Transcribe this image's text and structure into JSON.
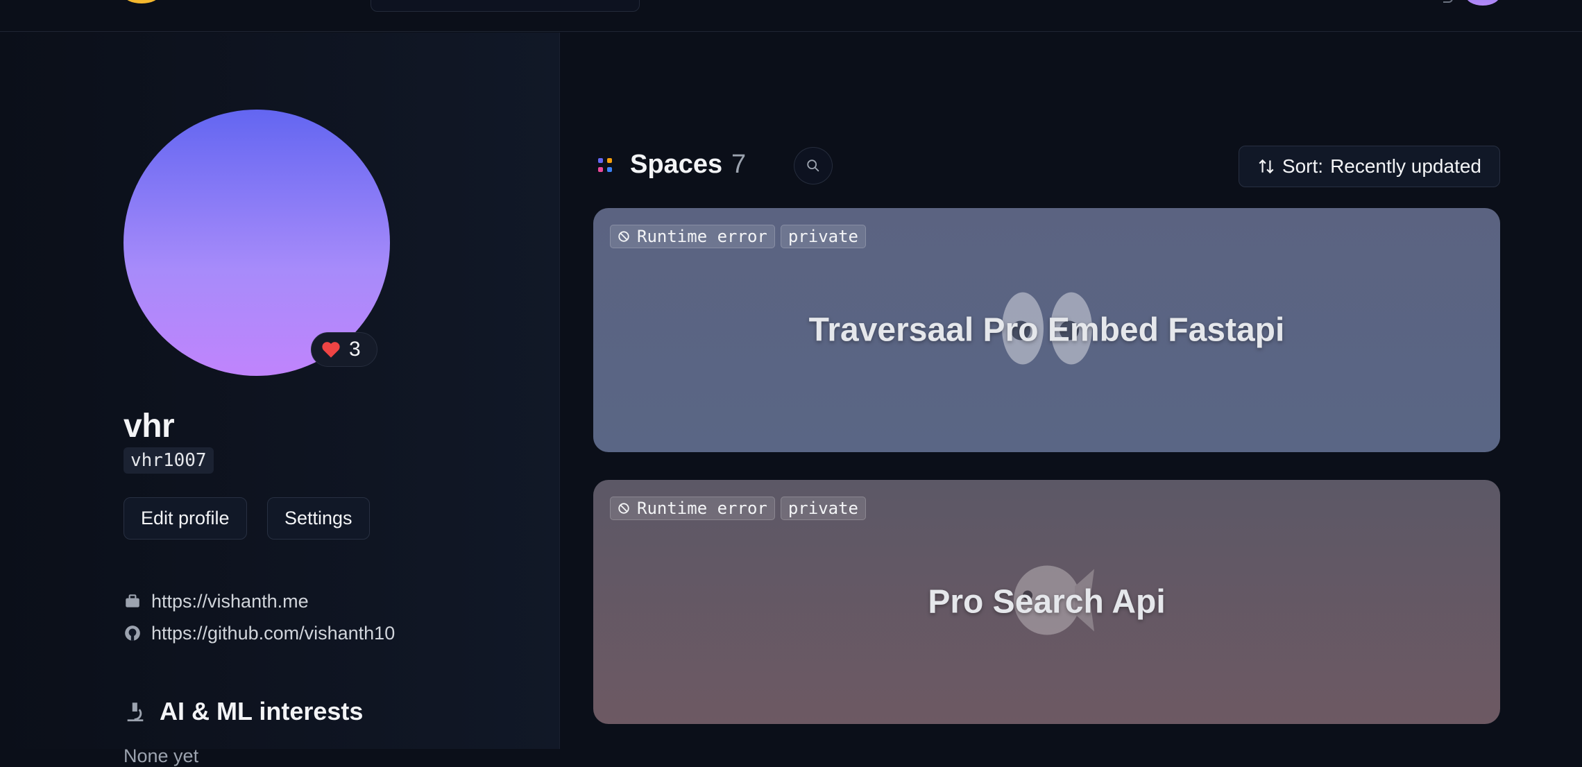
{
  "profile": {
    "display_name": "vhr",
    "username": "vhr1007",
    "likes": "3",
    "edit_label": "Edit profile",
    "settings_label": "Settings",
    "links": [
      {
        "icon": "briefcase-icon",
        "text": "https://vishanth.me"
      },
      {
        "icon": "github-icon",
        "text": "https://github.com/vishanth10"
      }
    ],
    "interests_title": "AI & ML interests",
    "interests_value": "None yet"
  },
  "spaces": {
    "title": "Spaces",
    "count": "7",
    "sort_prefix": "Sort:",
    "sort_value": "Recently updated",
    "items": [
      {
        "status": "Runtime error",
        "visibility": "private",
        "title": "Traversaal Pro Embed Fastapi",
        "emoji": "eyes-emoji",
        "color": "#5b6381"
      },
      {
        "status": "Runtime error",
        "visibility": "private",
        "title": "Pro Search Api",
        "emoji": "fish-emoji",
        "color": "#6d5963"
      }
    ]
  },
  "colors": {
    "background": "#0b0f19",
    "avatar_top": "#6366f1",
    "avatar_bottom": "#c084fc",
    "heart": "#ef4444"
  }
}
